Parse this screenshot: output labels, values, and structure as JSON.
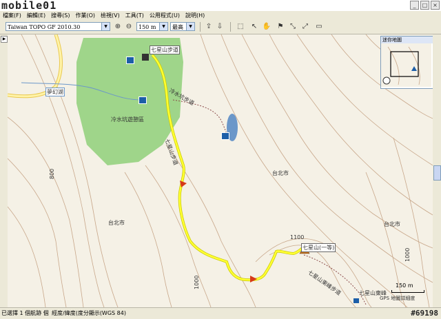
{
  "app": {
    "logo_text": "mobile01"
  },
  "menu": {
    "items": [
      "檔案(F)",
      "編輯(E)",
      "搜尋(S)",
      "作業(O)",
      "檢視(V)",
      "工具(T)",
      "公用程式(U)",
      "說明(H)"
    ]
  },
  "toolbar": {
    "map_select": "Taiwan TOPO GF 2010.30",
    "zoom_value": "150 m",
    "detail_value": "最高"
  },
  "map": {
    "labels": {
      "trail_top": "七星山步道",
      "trail_mid": "七星山步道",
      "trail_right": "七星山東峰步道",
      "peak": "七星山(一等)",
      "elev_peak": "1100",
      "elev_left": "800",
      "elev_bottom": "1000",
      "elev_bottom2": "1000",
      "city_left": "台北市",
      "city_mid": "台北市",
      "city_right": "台北市",
      "trail_left": "冷水坑步道",
      "area_green": "冷水坑遊憩區",
      "park_left": "夢幻湖",
      "end_label": "七星山東峰"
    },
    "minimap_title": "迷你地圖",
    "scale_label": "150 m",
    "credit": "GPS 地圖詳細度"
  },
  "status": {
    "selection": "已選擇 1 個航跡 個",
    "coord_format": "經度/緯度(度分顯示(WGS 84)",
    "watermark": "#69198"
  },
  "colors": {
    "map_bg": "#f5f1e6",
    "forest": "#8fd079",
    "contour": "#c8a78a",
    "track": "#ffff33",
    "road": "#f2d96b",
    "water": "#6b97c9"
  }
}
